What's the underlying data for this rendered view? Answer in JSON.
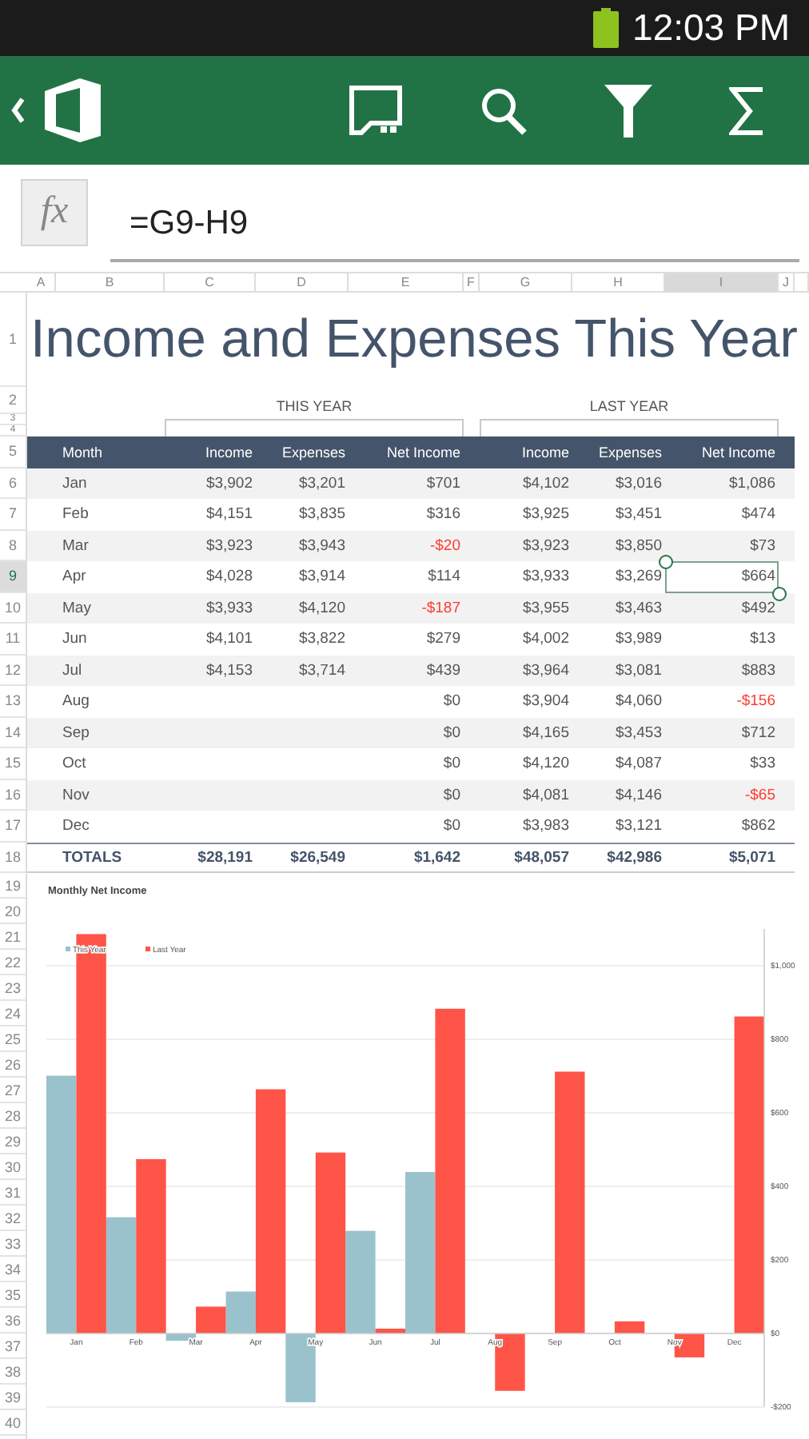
{
  "status_bar": {
    "time": "12:03 PM"
  },
  "formula_bar": {
    "fx_label": "fx",
    "formula": "=G9-H9"
  },
  "column_headers": [
    {
      "label": "A",
      "selected": false
    },
    {
      "label": "B",
      "selected": false
    },
    {
      "label": "C",
      "selected": false
    },
    {
      "label": "D",
      "selected": false
    },
    {
      "label": "E",
      "selected": false
    },
    {
      "label": "F",
      "selected": false
    },
    {
      "label": "G",
      "selected": false
    },
    {
      "label": "H",
      "selected": false
    },
    {
      "label": "I",
      "selected": true
    },
    {
      "label": "J",
      "selected": false
    }
  ],
  "row_headers": [
    {
      "label": "1",
      "selected": false
    },
    {
      "label": "2",
      "selected": false
    },
    {
      "label": "3",
      "selected": false
    },
    {
      "label": "4",
      "selected": false
    },
    {
      "label": "5",
      "selected": false
    },
    {
      "label": "6",
      "selected": false
    },
    {
      "label": "7",
      "selected": false
    },
    {
      "label": "8",
      "selected": false
    },
    {
      "label": "9",
      "selected": true
    },
    {
      "label": "10",
      "selected": false
    },
    {
      "label": "11",
      "selected": false
    },
    {
      "label": "12",
      "selected": false
    },
    {
      "label": "13",
      "selected": false
    },
    {
      "label": "14",
      "selected": false
    },
    {
      "label": "15",
      "selected": false
    },
    {
      "label": "16",
      "selected": false
    },
    {
      "label": "17",
      "selected": false
    },
    {
      "label": "18",
      "selected": false
    },
    {
      "label": "19",
      "selected": false
    },
    {
      "label": "20",
      "selected": false
    },
    {
      "label": "21",
      "selected": false
    },
    {
      "label": "22",
      "selected": false
    },
    {
      "label": "23",
      "selected": false
    },
    {
      "label": "24",
      "selected": false
    },
    {
      "label": "25",
      "selected": false
    },
    {
      "label": "26",
      "selected": false
    },
    {
      "label": "27",
      "selected": false
    },
    {
      "label": "28",
      "selected": false
    },
    {
      "label": "29",
      "selected": false
    },
    {
      "label": "30",
      "selected": false
    },
    {
      "label": "31",
      "selected": false
    },
    {
      "label": "32",
      "selected": false
    },
    {
      "label": "33",
      "selected": false
    },
    {
      "label": "34",
      "selected": false
    },
    {
      "label": "35",
      "selected": false
    },
    {
      "label": "36",
      "selected": false
    },
    {
      "label": "37",
      "selected": false
    },
    {
      "label": "38",
      "selected": false
    },
    {
      "label": "39",
      "selected": false
    },
    {
      "label": "40",
      "selected": false
    }
  ],
  "title": "Income and Expenses This Year",
  "groups": [
    "THIS YEAR",
    "LAST YEAR"
  ],
  "table": {
    "columns": [
      "Month",
      "Income",
      "Expenses",
      "Net Income",
      "Income",
      "Expenses",
      "Net Income"
    ],
    "rows": [
      {
        "cells": [
          "Jan",
          "$3,902",
          "$3,201",
          "$701",
          "$4,102",
          "$3,016",
          "$1,086"
        ],
        "this_year_net_negative": false,
        "last_year_net_negative": false
      },
      {
        "cells": [
          "Feb",
          "$4,151",
          "$3,835",
          "$316",
          "$3,925",
          "$3,451",
          "$474"
        ],
        "this_year_net_negative": false,
        "last_year_net_negative": false
      },
      {
        "cells": [
          "Mar",
          "$3,923",
          "$3,943",
          "-$20",
          "$3,923",
          "$3,850",
          "$73"
        ],
        "this_year_net_negative": true,
        "last_year_net_negative": false
      },
      {
        "cells": [
          "Apr",
          "$4,028",
          "$3,914",
          "$114",
          "$3,933",
          "$3,269",
          "$664"
        ],
        "this_year_net_negative": false,
        "last_year_net_negative": false
      },
      {
        "cells": [
          "May",
          "$3,933",
          "$4,120",
          "-$187",
          "$3,955",
          "$3,463",
          "$492"
        ],
        "this_year_net_negative": true,
        "last_year_net_negative": false
      },
      {
        "cells": [
          "Jun",
          "$4,101",
          "$3,822",
          "$279",
          "$4,002",
          "$3,989",
          "$13"
        ],
        "this_year_net_negative": false,
        "last_year_net_negative": false
      },
      {
        "cells": [
          "Jul",
          "$4,153",
          "$3,714",
          "$439",
          "$3,964",
          "$3,081",
          "$883"
        ],
        "this_year_net_negative": false,
        "last_year_net_negative": false
      },
      {
        "cells": [
          "Aug",
          null,
          null,
          "$0",
          "$3,904",
          "$4,060",
          "-$156"
        ],
        "this_year_net_negative": false,
        "last_year_net_negative": true
      },
      {
        "cells": [
          "Sep",
          null,
          null,
          "$0",
          "$4,165",
          "$3,453",
          "$712"
        ],
        "this_year_net_negative": false,
        "last_year_net_negative": false
      },
      {
        "cells": [
          "Oct",
          null,
          null,
          "$0",
          "$4,120",
          "$4,087",
          "$33"
        ],
        "this_year_net_negative": false,
        "last_year_net_negative": false
      },
      {
        "cells": [
          "Nov",
          null,
          null,
          "$0",
          "$4,081",
          "$4,146",
          "-$65"
        ],
        "this_year_net_negative": false,
        "last_year_net_negative": true
      },
      {
        "cells": [
          "Dec",
          null,
          null,
          "$0",
          "$3,983",
          "$3,121",
          "$862"
        ],
        "this_year_net_negative": false,
        "last_year_net_negative": false
      }
    ],
    "totals": [
      "TOTALS",
      "$28,191",
      "$26,549",
      "$1,642",
      "$48,057",
      "$42,986",
      "$5,071"
    ]
  },
  "chart": {
    "chart_data": {
      "type": "bar",
      "title": "Monthly Net Income",
      "categories": [
        "Jan",
        "Feb",
        "Mar",
        "Apr",
        "May",
        "Jun",
        "Jul",
        "Aug",
        "Sep",
        "Oct",
        "Nov",
        "Dec"
      ],
      "series": [
        {
          "name": "This Year",
          "color": "#9ac2cc",
          "values": [
            701,
            316,
            -20,
            114,
            -187,
            279,
            439,
            0,
            0,
            0,
            0,
            0
          ]
        },
        {
          "name": "Last Year",
          "color": "#ff5448",
          "values": [
            1086,
            474,
            73,
            664,
            492,
            13,
            883,
            -156,
            712,
            33,
            -65,
            862
          ]
        }
      ],
      "ylim": [
        -200,
        1100
      ],
      "grid": true,
      "legend": true,
      "yticks": [
        {
          "value": -200,
          "label": "-$200"
        },
        {
          "value": 0,
          "label": "$0"
        },
        {
          "value": 200,
          "label": "$200"
        },
        {
          "value": 400,
          "label": "$400"
        },
        {
          "value": 600,
          "label": "$600"
        },
        {
          "value": 800,
          "label": "$800"
        },
        {
          "value": 1000,
          "label": "$1,000"
        }
      ]
    }
  }
}
